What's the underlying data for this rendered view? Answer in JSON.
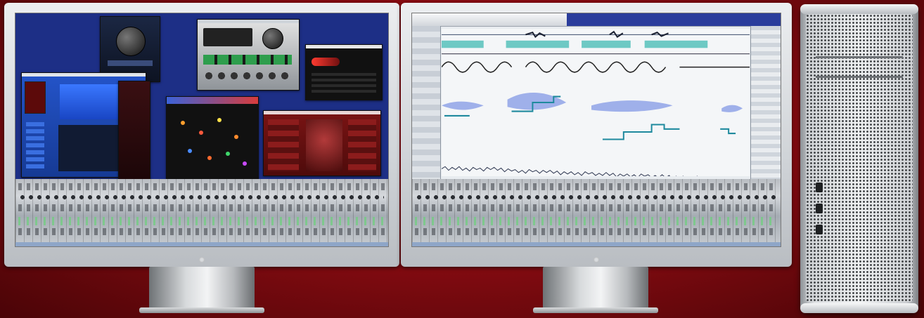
{
  "scene": {
    "description_free": true
  },
  "colors": {
    "background": "#8a0c12",
    "left_screen_bg": "#1d2f86",
    "daw_waveform": "#8fa3e8",
    "pitch_line": "#1f8a9e"
  },
  "icons": [
    "monitor-logo-icon",
    "monitor-logo-icon"
  ]
}
